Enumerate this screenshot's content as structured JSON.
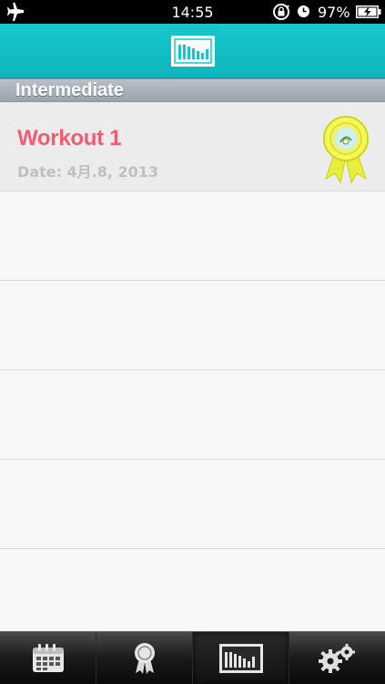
{
  "status_bar": {
    "time": "14:55",
    "battery_percent": "97%",
    "icons": [
      "airplane-icon",
      "rotation-lock-icon",
      "alarm-icon",
      "battery-charging-icon"
    ]
  },
  "nav_bar": {
    "logo_icon": "bar-chart-logo-icon"
  },
  "section": {
    "header": "Intermediate"
  },
  "workouts": [
    {
      "title": "Workout 1",
      "date": "Date: 4月.8, 2013",
      "badge_icon": "award-ribbon-icon",
      "selected": true
    }
  ],
  "tab_bar": {
    "tabs": [
      {
        "icon": "calendar-icon",
        "active": false
      },
      {
        "icon": "award-icon",
        "active": false
      },
      {
        "icon": "bar-chart-icon",
        "active": true
      },
      {
        "icon": "gears-icon",
        "active": false
      }
    ]
  },
  "colors": {
    "nav_bar": "#17c6cc",
    "workout_title": "#f25c73",
    "date_text": "#bfbfbf",
    "section_header": "#a9b2bb"
  }
}
